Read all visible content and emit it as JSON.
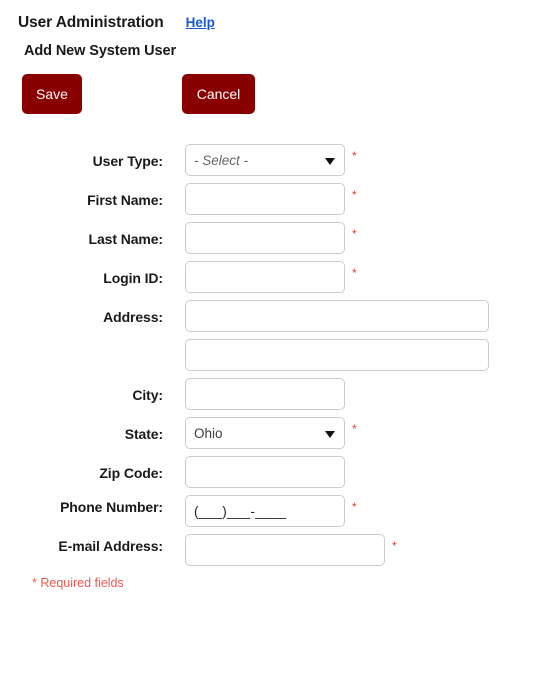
{
  "header": {
    "app_title": "User Administration",
    "help_label": "Help",
    "section_title": "Add New System User"
  },
  "toolbar": {
    "save_label": "Save",
    "cancel_label": "Cancel"
  },
  "form": {
    "fields": [
      {
        "label": "User Type:",
        "control": "select",
        "value": "- Select -",
        "placeholder_style": true,
        "required": true,
        "width": "narrow"
      },
      {
        "label": "First Name:",
        "control": "text",
        "value": "",
        "required": true,
        "width": "narrow"
      },
      {
        "label": "Last Name:",
        "control": "text",
        "value": "",
        "required": true,
        "width": "narrow"
      },
      {
        "label": "Login ID:",
        "control": "text",
        "value": "",
        "required": true,
        "width": "narrow"
      },
      {
        "label": "Address:",
        "control": "text",
        "value": "",
        "required": false,
        "width": "wide"
      },
      {
        "label": "",
        "control": "text",
        "value": "",
        "required": false,
        "width": "wide"
      },
      {
        "label": "City:",
        "control": "text",
        "value": "",
        "required": false,
        "width": "narrow"
      },
      {
        "label": "State:",
        "control": "select",
        "value": "Ohio",
        "placeholder_style": false,
        "required": true,
        "width": "narrow"
      },
      {
        "label": "Zip Code:",
        "control": "text",
        "value": "",
        "required": false,
        "width": "narrow"
      },
      {
        "label": "Phone Number:",
        "control": "phone",
        "value": "(___)___-____",
        "required": true,
        "width": "narrow"
      },
      {
        "label": "E-mail Address:",
        "control": "text",
        "value": "",
        "required": true,
        "width": "email"
      }
    ],
    "required_note": "* Required fields",
    "required_marker": "*"
  },
  "colors": {
    "button": "#8a0000",
    "link": "#1857d6",
    "required": "#f03a2e",
    "field_border": "#cccccc"
  }
}
